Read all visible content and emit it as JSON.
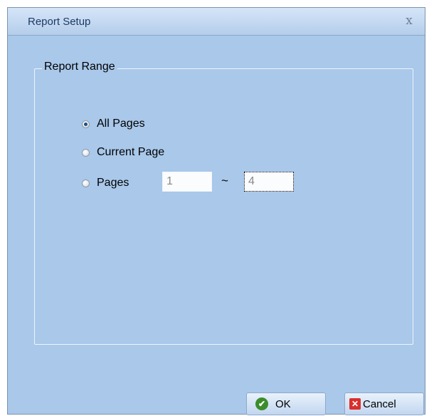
{
  "dialog": {
    "title": "Report Setup",
    "close_glyph": "x"
  },
  "report_range": {
    "legend": "Report Range",
    "options": [
      {
        "label": "All Pages",
        "checked": true
      },
      {
        "label": "Current Page",
        "checked": false
      },
      {
        "label": "Pages",
        "checked": false
      }
    ],
    "from_page": "1",
    "separator": "~",
    "to_page": "4"
  },
  "buttons": {
    "ok_label": "OK",
    "ok_icon": "check-icon",
    "cancel_label": "Cancel",
    "cancel_icon": "x-icon"
  },
  "colors": {
    "dialog_background": "#a9c8ea",
    "title_text": "#1e3a63",
    "ok_icon": "#3b8d2a",
    "cancel_icon": "#d9302b"
  }
}
